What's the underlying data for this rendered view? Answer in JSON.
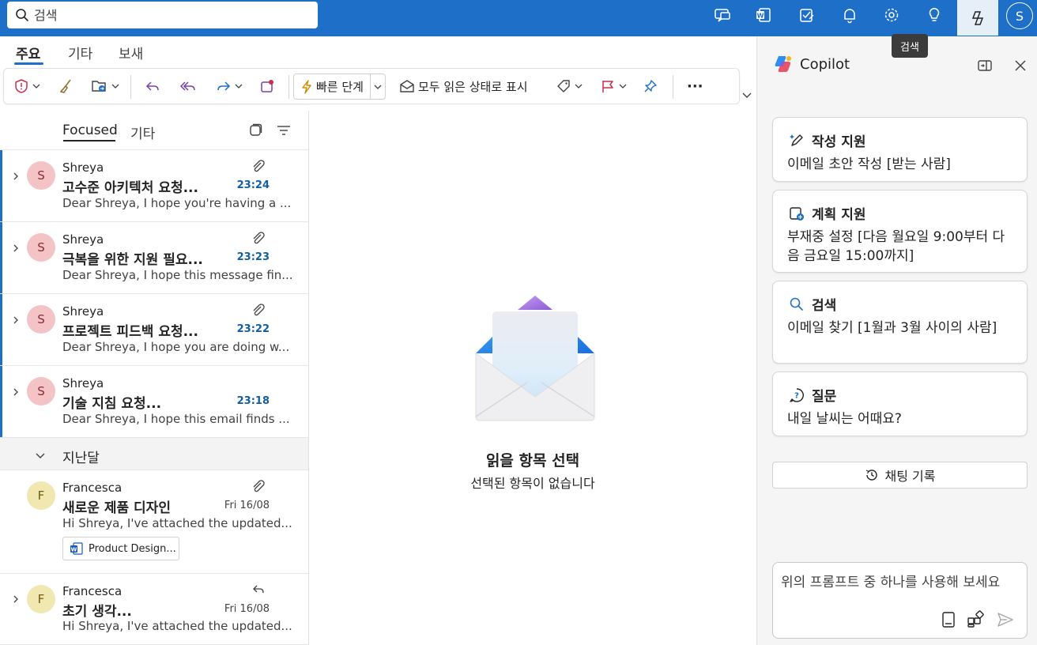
{
  "search": {
    "placeholder": "검색"
  },
  "topbar": {
    "icons": [
      "meet-now-icon",
      "word-icon",
      "tasks-icon",
      "bell-icon",
      "gear-icon",
      "lightbulb-icon",
      "copilot-icon"
    ],
    "avatar_initial": "S",
    "tooltip": "검색"
  },
  "ribbon": {
    "tabs": [
      "주요",
      "기타",
      "보새"
    ],
    "quick_steps_label": "빠른 단계",
    "mark_all_read_label": "모두 읽은 상태로 표시",
    "more_label": "···"
  },
  "list": {
    "tabs": {
      "focused": "Focused",
      "other": "기타"
    },
    "messages": [
      {
        "sender": "Shreya",
        "subject": "고수준 아키텍처 요청...",
        "preview": "Dear Shreya, I hope you're having a ...",
        "time": "23:24",
        "initial": "S"
      },
      {
        "sender": "Shreya",
        "subject": "극복을 위한 지원 필요...",
        "preview": "Dear Shreya, I hope this message fin...",
        "time": "23:23",
        "initial": "S"
      },
      {
        "sender": "Shreya",
        "subject": "프로젝트 피드백 요청...",
        "preview": "Dear Shreya, I hope you are doing w...",
        "time": "23:22",
        "initial": "S"
      },
      {
        "sender": "Shreya",
        "subject": "기술 지침 요청...",
        "preview": "Dear Shreya, I hope this email finds ...",
        "time": "23:18",
        "initial": "S"
      }
    ],
    "section_label": "지난달",
    "older": [
      {
        "sender": "Francesca",
        "subject": "새로운 제품 디자인",
        "preview": "Hi Shreya, I've attached the updated...",
        "time": "Fri 16/08",
        "initial": "F",
        "attachment": "Product Design..."
      },
      {
        "sender": "Francesca",
        "subject": "초기 생각...",
        "preview": "Hi Shreya, I've attached the updated...",
        "time": "Fri 16/08",
        "initial": "F"
      }
    ]
  },
  "reading": {
    "title": "읽을 항목 선택",
    "subtitle": "선택된 항목이 없습니다"
  },
  "copilot": {
    "title": "Copilot",
    "cards": [
      {
        "title": "작성 지원",
        "desc": "이메일 초안 작성 [받는 사람]",
        "icon": "pen-sparkle-icon"
      },
      {
        "title": "계획 지원",
        "desc": "부재중 설정 [다음 월요일 9:00부터 다음 금요일 15:00까지]",
        "icon": "calendar-add-icon"
      },
      {
        "title": "검색",
        "desc": "이메일 찾기 [1월과 3월 사이의 사람]",
        "icon": "search-icon"
      },
      {
        "title": "질문",
        "desc": "내일 날씨는 어때요?",
        "icon": "chat-question-icon"
      }
    ],
    "history_label": "채팅 기록",
    "prompt_placeholder": "위의 프롬프트 중 하나를 사용해 보세요"
  },
  "colors": {
    "accent": "#1d6fc7",
    "unread_time": "#115ea3",
    "avatar_pink": "#f3c3c6",
    "avatar_yellow": "#f1e7b0"
  }
}
